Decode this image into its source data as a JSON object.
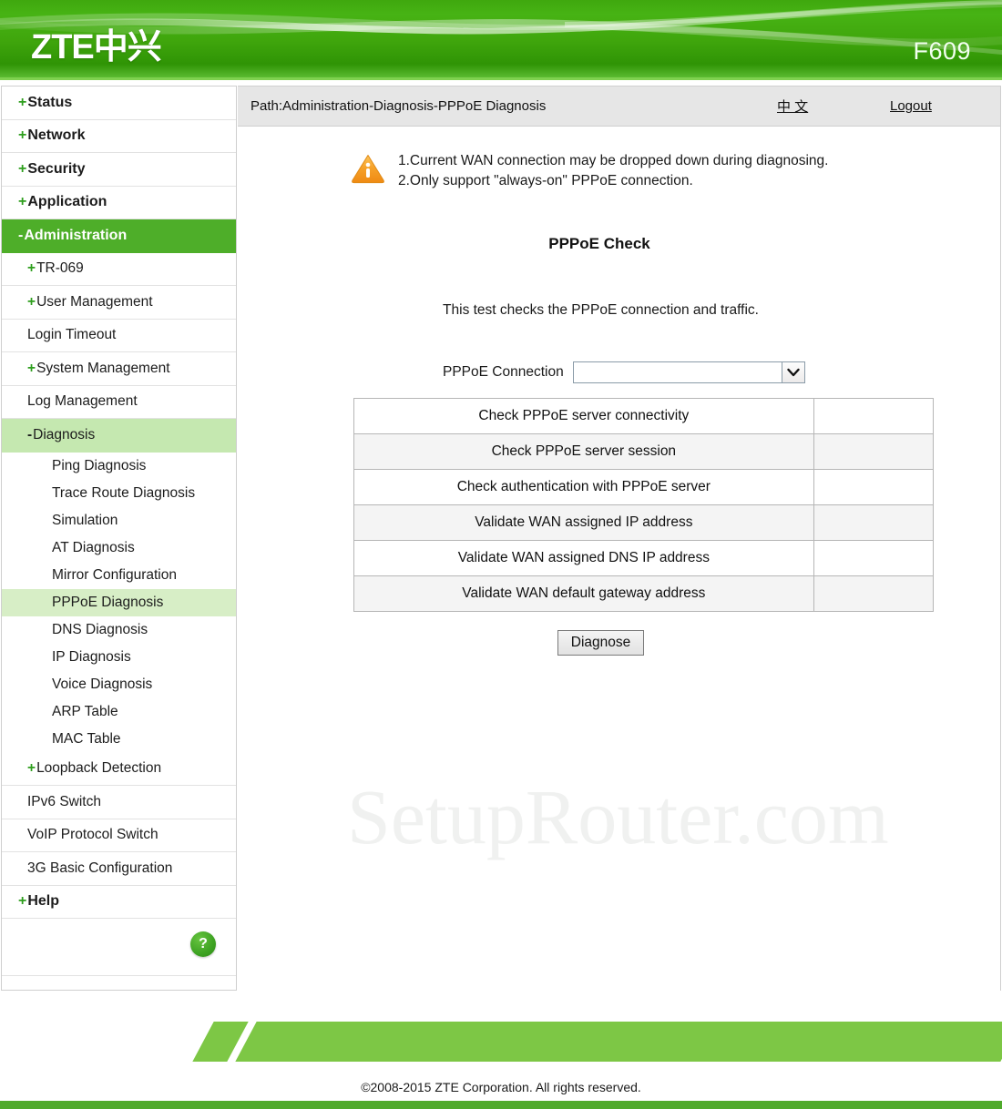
{
  "banner": {
    "logo": "ZTE中兴",
    "model": "F609"
  },
  "sidebar": {
    "items": [
      {
        "prefix": "+",
        "label": "Status",
        "level": "top",
        "state": "normal"
      },
      {
        "prefix": "+",
        "label": "Network",
        "level": "top",
        "state": "normal"
      },
      {
        "prefix": "+",
        "label": "Security",
        "level": "top",
        "state": "normal"
      },
      {
        "prefix": "+",
        "label": "Application",
        "level": "top",
        "state": "normal"
      },
      {
        "prefix": "-",
        "label": "Administration",
        "level": "top",
        "state": "active-main"
      },
      {
        "prefix": "+",
        "label": "TR-069",
        "level": "sub",
        "state": "normal"
      },
      {
        "prefix": "+",
        "label": "User Management",
        "level": "sub",
        "state": "normal"
      },
      {
        "prefix": "",
        "label": "Login Timeout",
        "level": "sub",
        "state": "normal"
      },
      {
        "prefix": "+",
        "label": "System Management",
        "level": "sub",
        "state": "normal"
      },
      {
        "prefix": "",
        "label": "Log Management",
        "level": "sub",
        "state": "normal"
      },
      {
        "prefix": "-",
        "label": "Diagnosis",
        "level": "sub",
        "state": "active-group"
      },
      {
        "prefix": "",
        "label": "Ping Diagnosis",
        "level": "leaf",
        "state": "normal"
      },
      {
        "prefix": "",
        "label": "Trace Route Diagnosis",
        "level": "leaf",
        "state": "normal"
      },
      {
        "prefix": "",
        "label": "Simulation",
        "level": "leaf",
        "state": "normal"
      },
      {
        "prefix": "",
        "label": "AT Diagnosis",
        "level": "leaf",
        "state": "normal"
      },
      {
        "prefix": "",
        "label": "Mirror Configuration",
        "level": "leaf",
        "state": "normal"
      },
      {
        "prefix": "",
        "label": "PPPoE Diagnosis",
        "level": "leaf",
        "state": "active-leaf"
      },
      {
        "prefix": "",
        "label": "DNS Diagnosis",
        "level": "leaf",
        "state": "normal"
      },
      {
        "prefix": "",
        "label": "IP Diagnosis",
        "level": "leaf",
        "state": "normal"
      },
      {
        "prefix": "",
        "label": "Voice Diagnosis",
        "level": "leaf",
        "state": "normal"
      },
      {
        "prefix": "",
        "label": "ARP Table",
        "level": "leaf",
        "state": "normal"
      },
      {
        "prefix": "",
        "label": "MAC Table",
        "level": "leaf",
        "state": "normal"
      },
      {
        "prefix": "+",
        "label": "Loopback Detection",
        "level": "sub",
        "state": "normal"
      },
      {
        "prefix": "",
        "label": "IPv6 Switch",
        "level": "sub",
        "state": "normal"
      },
      {
        "prefix": "",
        "label": "VoIP Protocol Switch",
        "level": "sub",
        "state": "normal"
      },
      {
        "prefix": "",
        "label": "3G Basic Configuration",
        "level": "sub",
        "state": "normal"
      },
      {
        "prefix": "+",
        "label": "Help",
        "level": "top",
        "state": "normal"
      }
    ],
    "help_button": "?"
  },
  "pathbar": {
    "path": "Path:Administration-Diagnosis-PPPoE Diagnosis",
    "language_link": "中 文",
    "logout_link": "Logout"
  },
  "notice": {
    "icon": "warning-triangle-icon",
    "line1": "1.Current WAN connection may be dropped down during diagnosing.",
    "line2": "2.Only support \"always-on\" PPPoE connection."
  },
  "main": {
    "title": "PPPoE Check",
    "description": "This test checks the PPPoE connection and traffic.",
    "connection_label": "PPPoE Connection",
    "connection_value": "",
    "connection_options": [],
    "diagnose_button": "Diagnose",
    "results": [
      {
        "check": "Check PPPoE server connectivity",
        "result": ""
      },
      {
        "check": "Check PPPoE server session",
        "result": ""
      },
      {
        "check": "Check authentication with PPPoE server",
        "result": ""
      },
      {
        "check": "Validate WAN assigned IP address",
        "result": ""
      },
      {
        "check": "Validate WAN assigned DNS IP address",
        "result": ""
      },
      {
        "check": "Validate WAN default gateway address",
        "result": ""
      }
    ]
  },
  "watermark": "SetupRouter.com",
  "footer": {
    "copyright": "©2008-2015 ZTE Corporation. All rights reserved."
  },
  "colors": {
    "brand_green": "#3fa80e",
    "active_green": "#4eae29",
    "group_green": "#c5e8b0",
    "leaf_green": "#d7eec6",
    "footer_green": "#7dc745",
    "warning_orange": "#f5a623"
  }
}
